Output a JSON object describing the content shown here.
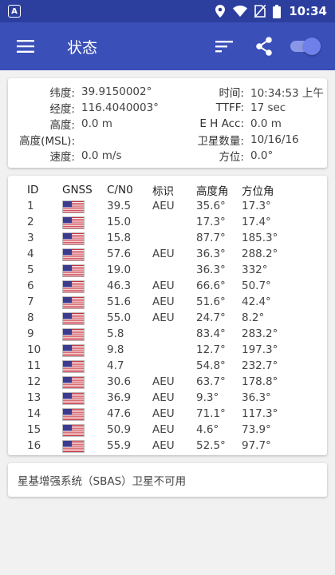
{
  "status_bar": {
    "time": "10:34",
    "icons": [
      "app-a-icon",
      "location-icon",
      "wifi-icon",
      "no-sim-icon",
      "battery-icon"
    ]
  },
  "app_bar": {
    "title": "状态",
    "icons": [
      "menu-icon",
      "sort-icon",
      "share-icon",
      "toggle-switch"
    ]
  },
  "status": {
    "rows": [
      {
        "label": "纬度:",
        "value": "39.9150002°",
        "label2": "时间:",
        "value2": "10:34:53 上午"
      },
      {
        "label": "经度:",
        "value": "116.4040003°",
        "label2": "TTFF:",
        "value2": "17 sec"
      },
      {
        "label": "高度:",
        "value": "0.0 m",
        "label2": "E H Acc:",
        "value2": "0.0 m"
      },
      {
        "label": "高度(MSL):",
        "value": "",
        "label2": "卫星数量:",
        "value2": "10/16/16"
      },
      {
        "label": "速度:",
        "value": "0.0 m/s",
        "label2": "方位:",
        "value2": "0.0°"
      }
    ]
  },
  "satellites": {
    "headers": {
      "id": "ID",
      "gnss": "GNSS",
      "cn0": "C/N0",
      "flags": "标识",
      "elevation": "高度角",
      "azimuth": "方位角"
    },
    "rows": [
      {
        "id": "1",
        "cn0": "39.5",
        "flags": "AEU",
        "elevation": "35.6°",
        "azimuth": "17.3°"
      },
      {
        "id": "2",
        "cn0": "15.0",
        "flags": "",
        "elevation": "17.3°",
        "azimuth": "17.4°"
      },
      {
        "id": "3",
        "cn0": "15.8",
        "flags": "",
        "elevation": "87.7°",
        "azimuth": "185.3°"
      },
      {
        "id": "4",
        "cn0": "57.6",
        "flags": "AEU",
        "elevation": "36.3°",
        "azimuth": "288.2°"
      },
      {
        "id": "5",
        "cn0": "19.0",
        "flags": "",
        "elevation": "36.3°",
        "azimuth": "332°"
      },
      {
        "id": "6",
        "cn0": "46.3",
        "flags": "AEU",
        "elevation": "66.6°",
        "azimuth": "50.7°"
      },
      {
        "id": "7",
        "cn0": "51.6",
        "flags": "AEU",
        "elevation": "51.6°",
        "azimuth": "42.4°"
      },
      {
        "id": "8",
        "cn0": "55.0",
        "flags": "AEU",
        "elevation": "24.7°",
        "azimuth": "8.2°"
      },
      {
        "id": "9",
        "cn0": "5.8",
        "flags": "",
        "elevation": "83.4°",
        "azimuth": "283.2°"
      },
      {
        "id": "10",
        "cn0": "9.8",
        "flags": "",
        "elevation": "12.7°",
        "azimuth": "197.3°"
      },
      {
        "id": "11",
        "cn0": "4.7",
        "flags": "",
        "elevation": "54.8°",
        "azimuth": "232.7°"
      },
      {
        "id": "12",
        "cn0": "30.6",
        "flags": "AEU",
        "elevation": "63.7°",
        "azimuth": "178.8°"
      },
      {
        "id": "13",
        "cn0": "36.9",
        "flags": "AEU",
        "elevation": "9.3°",
        "azimuth": "36.3°"
      },
      {
        "id": "14",
        "cn0": "47.6",
        "flags": "AEU",
        "elevation": "71.1°",
        "azimuth": "117.3°"
      },
      {
        "id": "15",
        "cn0": "50.9",
        "flags": "AEU",
        "elevation": "4.6°",
        "azimuth": "73.9°"
      },
      {
        "id": "16",
        "cn0": "55.9",
        "flags": "AEU",
        "elevation": "52.5°",
        "azimuth": "97.7°"
      }
    ]
  },
  "sbas": {
    "message": "星基增强系统（SBAS）卫星不可用"
  },
  "colors": {
    "status_bar": "#2d3f9e",
    "app_bar": "#3a4fb8",
    "toggle_accent": "#6f80ea",
    "background": "#f1f1f1"
  }
}
